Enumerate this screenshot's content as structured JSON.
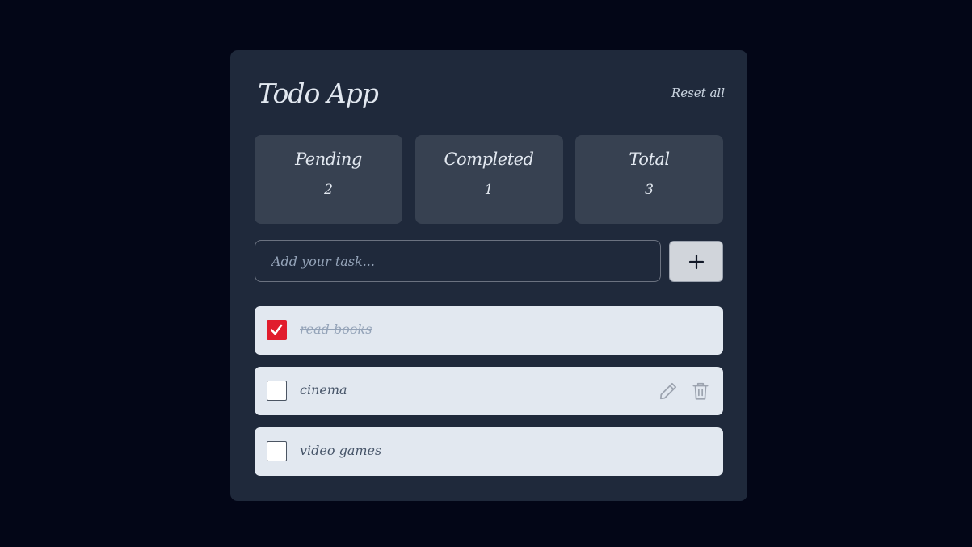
{
  "app": {
    "title": "Todo App",
    "reset_label": "Reset all"
  },
  "stats": [
    {
      "label": "Pending",
      "value": "2"
    },
    {
      "label": "Completed",
      "value": "1"
    },
    {
      "label": "Total",
      "value": "3"
    }
  ],
  "input": {
    "placeholder": "Add your task...",
    "value": "",
    "add_icon": "plus-icon"
  },
  "todos": [
    {
      "text": "read books",
      "completed": true
    },
    {
      "text": "cinema",
      "completed": false,
      "actions": [
        "pencil-icon",
        "trash-icon"
      ]
    },
    {
      "text": "video games",
      "completed": false
    }
  ],
  "colors": {
    "page_background": "#030617",
    "card_background": "#1f293b",
    "stat_background": "#374151",
    "item_background": "#e2e8f0",
    "checked_accent": "#e11d2e"
  }
}
